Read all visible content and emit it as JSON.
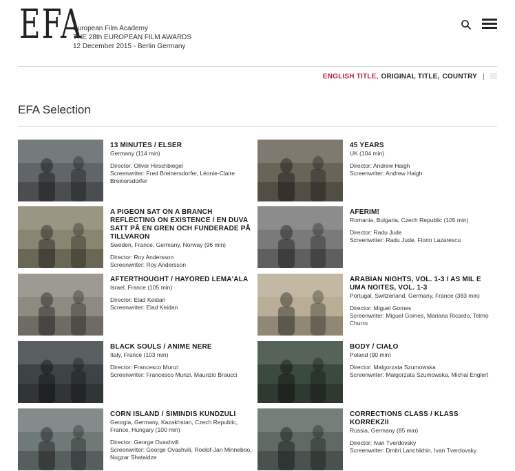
{
  "header": {
    "logo": "EFA",
    "lines": [
      "European Film Academy",
      "THE 28th EUROPEAN FILM AWARDS",
      "12 December 2015 - Berlin Germany"
    ]
  },
  "sort": {
    "english_title": "ENGLISH TITLE,",
    "original_title": "ORIGINAL TITLE,",
    "country": "COUNTRY",
    "separator": "|"
  },
  "section": {
    "title": "EFA Selection"
  },
  "films": [
    {
      "title": "13 MINUTES / ELSER",
      "country": "Germany (114 min)",
      "director": "Director: Oliver Hirschbiegel",
      "screenwriter": "Screenwriter: Fred Breinersdorfer, Léonie-Claire Breinersdorfer",
      "bg": "#5f6568"
    },
    {
      "title": "45 YEARS",
      "country": "UK (104 min)",
      "director": "Director: Andrew Haigh",
      "screenwriter": "Screenwriter: Andrew Haigh",
      "bg": "#6a6458"
    },
    {
      "title": "A PIGEON SAT ON A BRANCH REFLECTING ON EXISTENCE / EN DUVA SATT PÅ EN GREN OCH FUNDERADE PÅ TILLVARON",
      "country": "Sweden, France, Germany, Norway (96 min)",
      "director": "Director: Roy Andersson",
      "screenwriter": "Screenwriter: Roy Andersson",
      "bg": "#8a8570"
    },
    {
      "title": "AFERIM!",
      "country": "Romania, Bulgaria, Czech Republic (105 min)",
      "director": "Director: Radu Jude",
      "screenwriter": "Screenwriter: Radu Jude, Florin Lazarescu",
      "bg": "#7a7a7a"
    },
    {
      "title": "AFTERTHOUGHT / HAYORED LEMA'ALA",
      "country": "Israel, France (105 min)",
      "director": "Director: Elad Keidan",
      "screenwriter": "Screenwriter: Elad Keidan",
      "bg": "#8d8a80"
    },
    {
      "title": "ARABIAN NIGHTS, VOL. 1-3 / AS MIL E UMA NOITES, VOL. 1-3",
      "country": "Portugal, Switzerland, Germany, France (383 min)",
      "director": "Director: Miguel Gomes",
      "screenwriter": "Screenwriter: Miguel Gomes, Mariana Ricardo, Telmo Churro",
      "bg": "#b9ad96"
    },
    {
      "title": "BLACK SOULS / ANIME NERE",
      "country": "Italy, France (103 min)",
      "director": "Director: Francesco Munzi",
      "screenwriter": "Screenwriter: Francesco Munzi, Maurizio Braucci",
      "bg": "#3e4446"
    },
    {
      "title": "BODY / CIAŁO",
      "country": "Poland (90 min)",
      "director": "Director: Malgorzata Szumowska",
      "screenwriter": "Screenwriter: Malgorzata Szumowska, Michal Englert",
      "bg": "#3b4a3e"
    },
    {
      "title": "CORN ISLAND / SIMINDIS KUNDZULI",
      "country": "Georgia, Germany, Kazakhstan, Czech Republic, France, Hungary (100 min)",
      "director": "Director: George Ovashvili",
      "screenwriter": "Screenwriter: George Ovashvili, Roelof-Jan Minneboo, Nugzar Shataidze",
      "bg": "#6f7a78"
    },
    {
      "title": "CORRECTIONS CLASS / KLASS KORREKZII",
      "country": "Russia, Germany (85 min)",
      "director": "Director: Ivan Tverdovsky",
      "screenwriter": "Screenwriter: Dmitri Lanchikhin, Ivan Tverdovsky",
      "bg": "#5e6a63"
    }
  ]
}
